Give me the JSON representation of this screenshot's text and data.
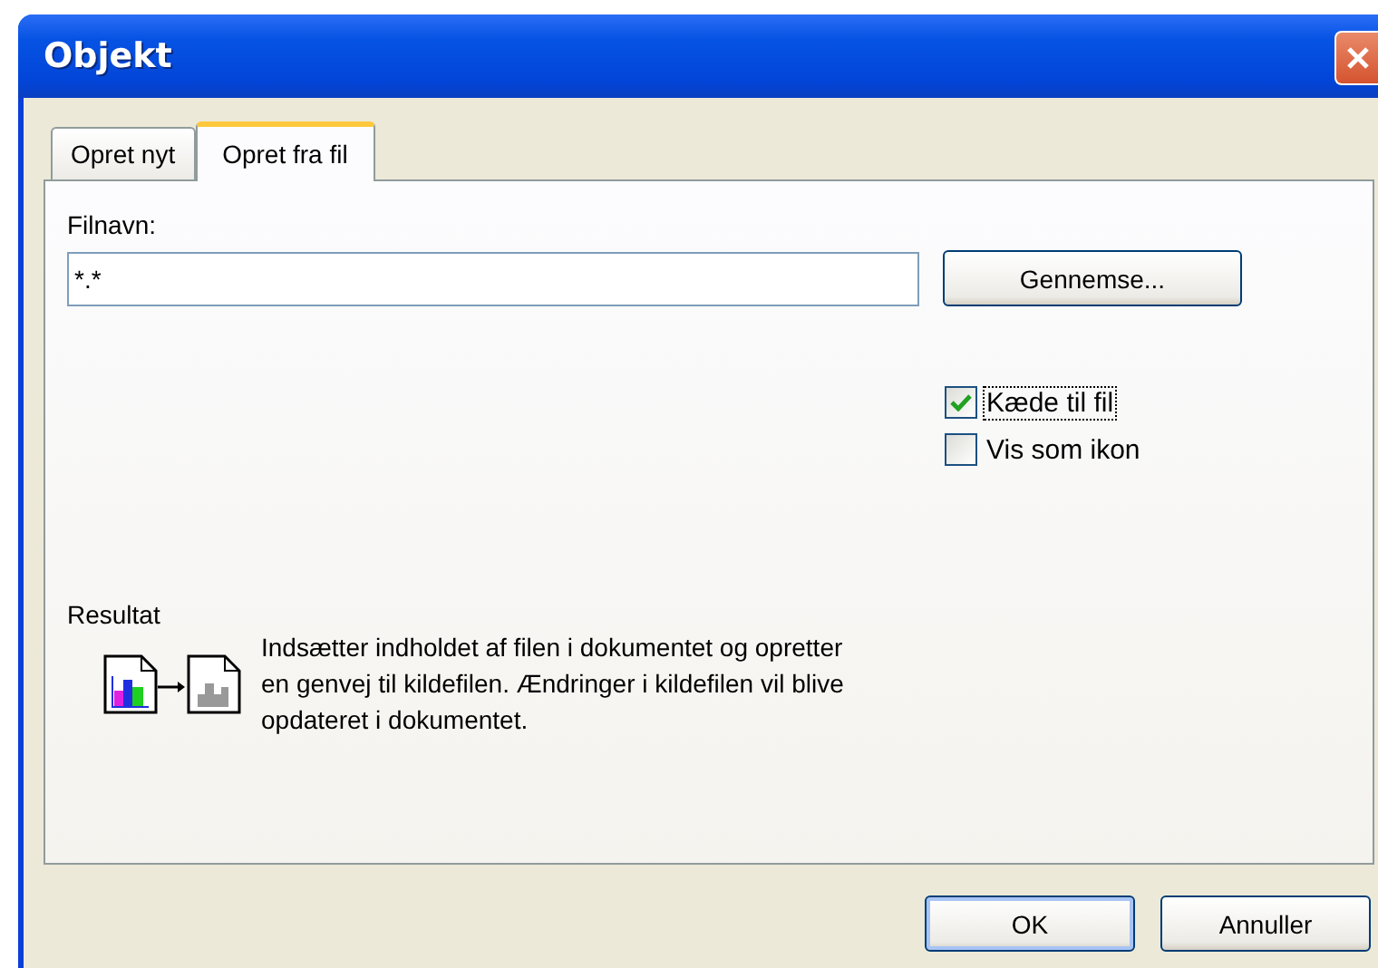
{
  "window": {
    "title": "Objekt"
  },
  "tabs": [
    {
      "label": "Opret nyt",
      "selected": false
    },
    {
      "label": "Opret fra fil",
      "selected": true
    }
  ],
  "file_name": {
    "label": "Filnavn:",
    "value": "*.*"
  },
  "browse_button": "Gennemse...",
  "options": [
    {
      "label": "Kæde til fil",
      "checked": true,
      "focused": true
    },
    {
      "label": "Vis som ikon",
      "checked": false,
      "focused": false
    }
  ],
  "result": {
    "label": "Resultat",
    "description": "Indsætter indholdet af filen i dokumentet og opretter en genvej til kildefilen. Ændringer i kildefilen vil blive opdateret i dokumentet."
  },
  "buttons": [
    {
      "label": "OK",
      "default": true
    },
    {
      "label": "Annuller",
      "default": false
    }
  ]
}
